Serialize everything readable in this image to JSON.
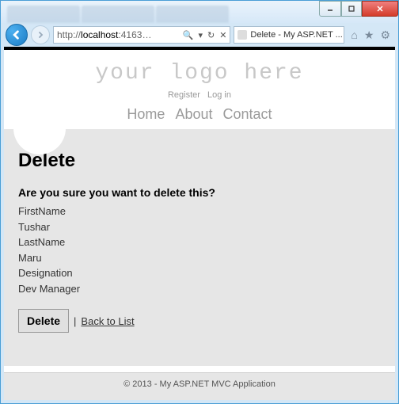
{
  "browser": {
    "url_prefix": "http://",
    "url_host": "localhost",
    "url_port": ":4163",
    "search_glyph": "🔍",
    "dropdown_glyph": "▾",
    "refresh_glyph": "↻",
    "stop_glyph": "✕",
    "tab_title": "Delete - My ASP.NET ...",
    "tab_close": "×",
    "home_glyph": "⌂",
    "star_glyph": "★",
    "gear_glyph": "⚙"
  },
  "window_controls": {
    "min": "_",
    "max": "▭",
    "close": "✕"
  },
  "header": {
    "logo_text": "your logo here",
    "register": "Register",
    "login": "Log in",
    "nav": {
      "home": "Home",
      "about": "About",
      "contact": "Contact"
    }
  },
  "page": {
    "heading": "Delete",
    "confirm": "Are you sure you want to delete this?",
    "fields": {
      "firstNameLabel": "FirstName",
      "firstNameValue": "Tushar",
      "lastNameLabel": "LastName",
      "lastNameValue": "Maru",
      "designationLabel": "Designation",
      "designationValue": "Dev Manager"
    },
    "delete_button": "Delete",
    "separator": "|",
    "back_link": "Back to List"
  },
  "footer": {
    "text": "© 2013 - My ASP.NET MVC Application"
  }
}
